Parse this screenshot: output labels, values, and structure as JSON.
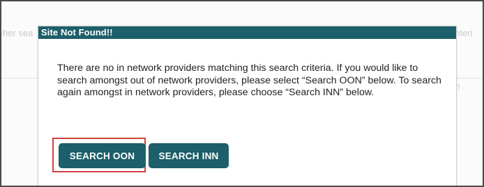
{
  "background": {
    "left_text": "her sea",
    "right_text": "nteri",
    "right_small": "h"
  },
  "modal": {
    "title": "Site Not Found!!",
    "message": "There are no in network providers matching this search criteria. If you would like to search amongst out of network providers, please select “Search OON” below. To search again amongst in network providers, please choose “Search INN” below."
  },
  "buttons": {
    "search_oon": "SEARCH OON",
    "search_inn": "SEARCH INN"
  },
  "colors": {
    "accent": "#1d5f6a",
    "highlight_border": "#d24040"
  }
}
